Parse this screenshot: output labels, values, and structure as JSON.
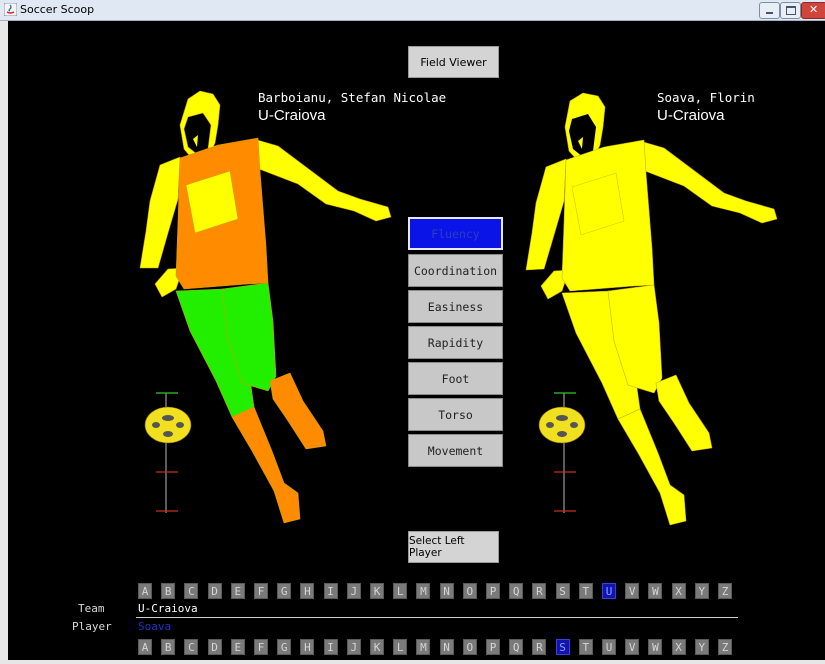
{
  "window": {
    "title": "Soccer Scoop"
  },
  "buttons": {
    "field_viewer": "Field Viewer",
    "select_left": "Select Left Player"
  },
  "left_player": {
    "name": "Barboianu, Stefan Nicolae",
    "team": "U-Craiova"
  },
  "right_player": {
    "name": "Soava, Florin",
    "team": "U-Craiova"
  },
  "attributes": {
    "selected": "Fluency",
    "items": [
      "Fluency",
      "Coordination",
      "Easiness",
      "Rapidity",
      "Foot",
      "Torso",
      "Movement"
    ]
  },
  "selector": {
    "team_label": "Team",
    "team_value": "U-Craiova",
    "player_label": "Player",
    "player_value": "Soava",
    "letters": [
      "A",
      "B",
      "C",
      "D",
      "E",
      "F",
      "G",
      "H",
      "I",
      "J",
      "K",
      "L",
      "M",
      "N",
      "O",
      "P",
      "Q",
      "R",
      "S",
      "T",
      "U",
      "V",
      "W",
      "X",
      "Y",
      "Z"
    ],
    "team_selected_letter": "U",
    "player_selected_letter": "S"
  },
  "colors": {
    "background": "#000000",
    "body_yellow": "#ffff00",
    "body_orange": "#ff8c00",
    "body_green": "#22ee00",
    "selected_blue": "#0a14e6"
  },
  "left_body_part_colors": {
    "head": "#ffff00",
    "arms": "#ffff00",
    "torso": "#ff8c00",
    "chest_panel": "#ffff00",
    "thighs": "#22ee00",
    "shins": "#ff8c00"
  }
}
